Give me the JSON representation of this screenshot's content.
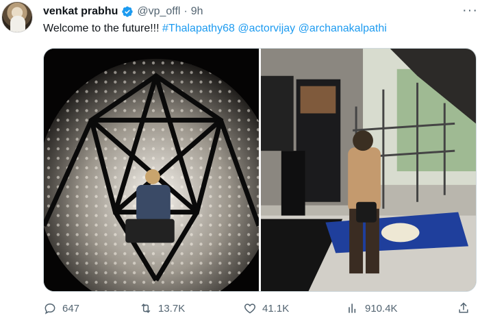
{
  "tweet": {
    "author_name": "venkat prabhu",
    "handle": "@vp_offl",
    "separator": "·",
    "time": "9h",
    "text_plain": "Welcome to the future!!! ",
    "hashtag": "#Thalapathy68",
    "mention_1": "@actorvijay",
    "mention_2": "@archanakalpathi"
  },
  "media": [
    {
      "subject": "LED light-stage sphere with person seated inside"
    },
    {
      "subject": "visitor viewing exhibit with flag rug and camera rig"
    }
  ],
  "actions": {
    "reply_count": "647",
    "retweet_count": "13.7K",
    "like_count": "41.1K",
    "view_count": "910.4K"
  },
  "colors": {
    "accent": "#1d9bf0",
    "secondary_text": "#536471",
    "primary_text": "#0f1419"
  },
  "icons": [
    "verified-badge-icon",
    "more-icon",
    "reply-icon",
    "retweet-icon",
    "like-icon",
    "views-icon",
    "share-icon"
  ]
}
